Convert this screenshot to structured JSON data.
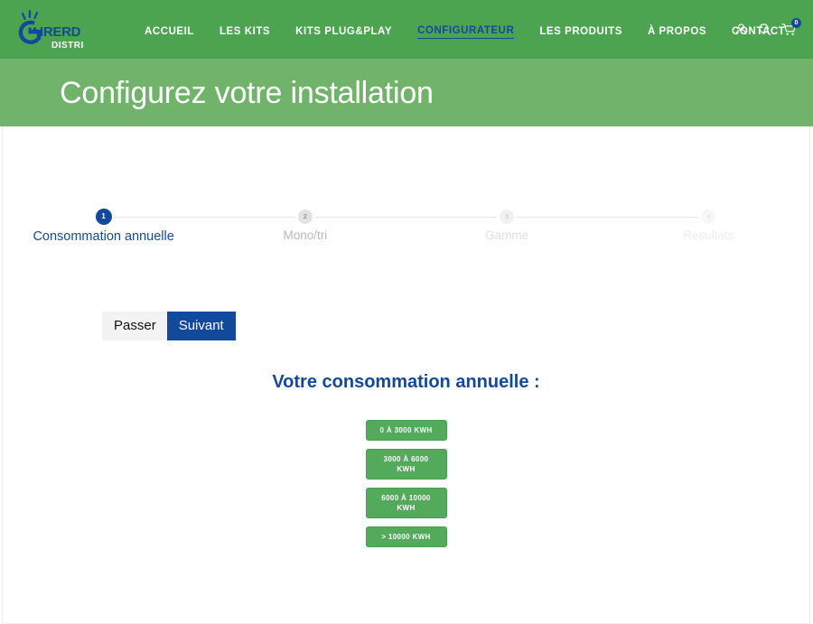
{
  "brand": {
    "logo_text_main": "GIRERD",
    "logo_text_sub": "DISTRI",
    "nav_bg": "#4ca451",
    "hero_bg": "#71b36b",
    "accent_blue": "#13499a",
    "choice_green": "#52aa5a"
  },
  "nav": {
    "links": [
      {
        "label": "ACCUEIL",
        "active": false
      },
      {
        "label": "LES KITS",
        "active": false
      },
      {
        "label": "KITS PLUG&PLAY",
        "active": false
      },
      {
        "label": "CONFIGURATEUR",
        "active": true
      },
      {
        "label": "LES PRODUITS",
        "active": false
      },
      {
        "label": "À PROPOS",
        "active": false
      },
      {
        "label": "CONTACT",
        "active": false
      }
    ],
    "icons": [
      {
        "name": "account-icon"
      },
      {
        "name": "search-icon"
      },
      {
        "name": "cart-icon"
      }
    ],
    "cart_count": "0"
  },
  "hero": {
    "title": "Configurez votre installation"
  },
  "stepper": {
    "steps": [
      {
        "number": "1",
        "label": "Consommation annuelle",
        "state": "active"
      },
      {
        "number": "2",
        "label": "Mono/tri",
        "state": "inactive"
      },
      {
        "number": "3",
        "label": "Gamme",
        "state": "faded"
      },
      {
        "number": "4",
        "label": "Resultats",
        "state": "faded2"
      }
    ]
  },
  "controls": {
    "skip_label": "Passer",
    "next_label": "Suivant"
  },
  "question": {
    "heading": "Votre consommation annuelle :",
    "options": [
      {
        "label": "0 à 3000 KWH"
      },
      {
        "label": "3000 à 6000 KWH"
      },
      {
        "label": "6000 à 10000 KWH"
      },
      {
        "label": "> 10000 KWH"
      }
    ]
  }
}
